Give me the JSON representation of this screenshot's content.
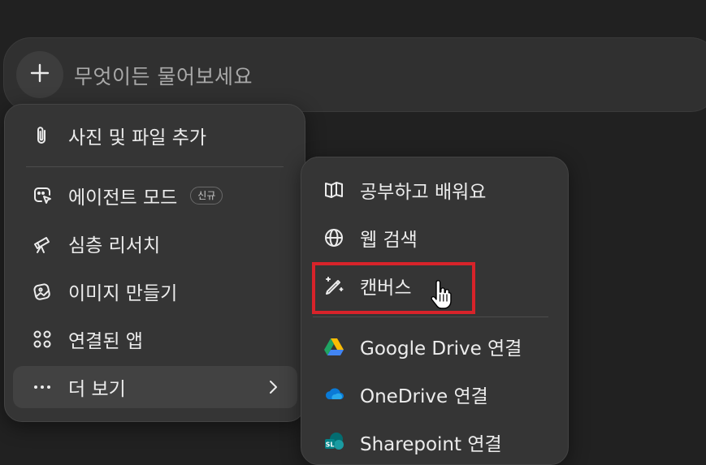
{
  "prompt": {
    "placeholder": "무엇이든 물어보세요",
    "plus_icon": "plus-icon"
  },
  "left_menu": {
    "items": [
      {
        "label": "사진 및 파일 추가",
        "icon": "paperclip-icon"
      },
      {
        "label": "에이전트 모드",
        "icon": "agent-icon",
        "badge": "신규"
      },
      {
        "label": "심층 리서치",
        "icon": "telescope-icon"
      },
      {
        "label": "이미지 만들기",
        "icon": "image-icon"
      },
      {
        "label": "연결된 앱",
        "icon": "apps-icon"
      },
      {
        "label": "더 보기",
        "icon": "more-icon"
      }
    ]
  },
  "right_menu": {
    "items": [
      {
        "label": "공부하고 배워요",
        "icon": "book-icon"
      },
      {
        "label": "웹 검색",
        "icon": "globe-icon"
      },
      {
        "label": "캔버스",
        "icon": "pencil-sparkle-icon"
      },
      {
        "label": "Google Drive 연결",
        "icon": "google-drive-icon"
      },
      {
        "label": "OneDrive 연결",
        "icon": "onedrive-icon"
      },
      {
        "label": "Sharepoint 연결",
        "icon": "sharepoint-icon"
      }
    ]
  },
  "colors": {
    "background": "#212121",
    "menu": "#353535",
    "highlight": "#d8232a"
  }
}
